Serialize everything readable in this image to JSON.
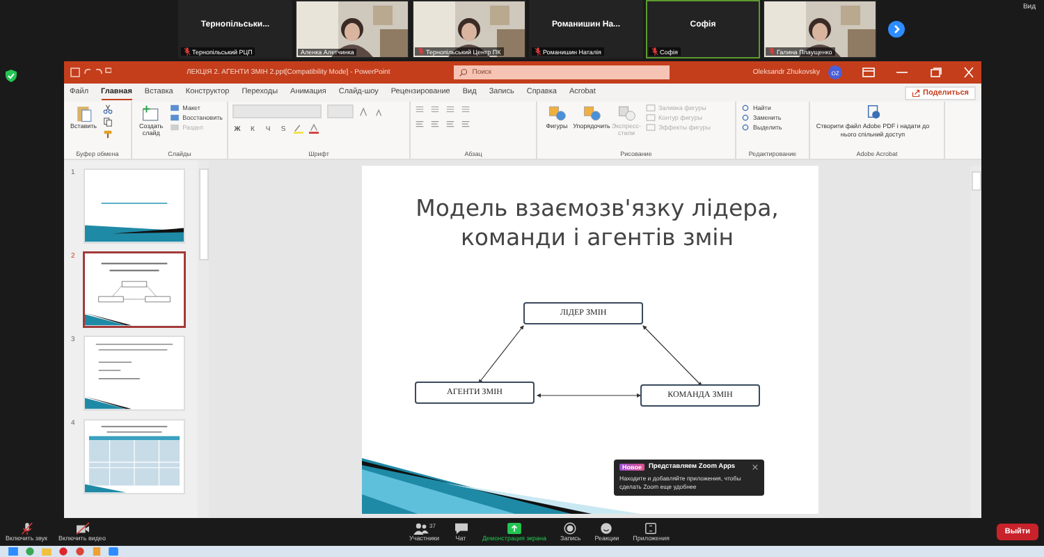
{
  "participants": [
    {
      "kind": "name",
      "name": "Тернопільськи...",
      "label": "Тернопільський РЦП",
      "muted": true,
      "speaking": false
    },
    {
      "kind": "video",
      "label": "Аленка Алетчинка",
      "muted": false,
      "speaking": false
    },
    {
      "kind": "video",
      "label": "Тернопільський Центр ПК",
      "muted": true,
      "speaking": false
    },
    {
      "kind": "name",
      "name": "Романишин  На...",
      "label": "Романишин Наталія",
      "muted": true,
      "speaking": false
    },
    {
      "kind": "name",
      "name": "Софія",
      "label": "Софія",
      "muted": true,
      "speaking": true
    },
    {
      "kind": "video",
      "label": "Галина Плаущенко",
      "muted": true,
      "speaking": false
    }
  ],
  "view_button": "Вид",
  "window": {
    "title": "ЛЕКЦІЯ 2. АГЕНТИ ЗМІН 2.ppt[Compatibility Mode]  -  PowerPoint",
    "search": {
      "placeholder": "Поиск"
    },
    "user": "Oleksandr Zhukovsky",
    "avatar": "OZ"
  },
  "tabs": [
    {
      "label": "Файл",
      "selected": false
    },
    {
      "label": "Главная",
      "selected": true
    },
    {
      "label": "Вставка",
      "selected": false
    },
    {
      "label": "Конструктор",
      "selected": false
    },
    {
      "label": "Переходы",
      "selected": false
    },
    {
      "label": "Анимация",
      "selected": false
    },
    {
      "label": "Слайд-шоу",
      "selected": false
    },
    {
      "label": "Рецензирование",
      "selected": false
    },
    {
      "label": "Вид",
      "selected": false
    },
    {
      "label": "Запись",
      "selected": false
    },
    {
      "label": "Справка",
      "selected": false
    },
    {
      "label": "Acrobat",
      "selected": false
    }
  ],
  "share_button": "Поделиться",
  "ribbon": [
    {
      "kind": "clipboard",
      "label": "Буфер обмена",
      "items": [
        {
          "label": "Вставить",
          "disabled": false
        }
      ]
    },
    {
      "kind": "slides",
      "label": "Слайды",
      "items": [
        {
          "label": "Создать слайд",
          "disabled": false
        },
        {
          "label": "Макет",
          "disabled": false
        },
        {
          "label": "Восстановить",
          "disabled": false
        },
        {
          "label": "Раздел",
          "disabled": true
        }
      ]
    },
    {
      "kind": "font",
      "label": "Шрифт",
      "items": [
        {
          "label": "Ж",
          "disabled": false
        },
        {
          "label": "К",
          "disabled": false
        },
        {
          "label": "Ч",
          "disabled": false
        },
        {
          "label": "S",
          "disabled": false
        }
      ]
    },
    {
      "kind": "paragraph",
      "label": "Абзац"
    },
    {
      "kind": "drawing",
      "label": "Рисование",
      "items": [
        {
          "label": "Фигуры",
          "disabled": false
        },
        {
          "label": "Упорядочить",
          "disabled": false
        },
        {
          "label": "Экспресс-стили",
          "disabled": true
        },
        {
          "label": "Заливка фигуры",
          "disabled": true
        },
        {
          "label": "Контур фигуры",
          "disabled": true
        },
        {
          "label": "Эффекты фигуры",
          "disabled": true
        }
      ]
    },
    {
      "kind": "editing",
      "label": "Редактирование",
      "items": [
        {
          "label": "Найти",
          "disabled": false
        },
        {
          "label": "Заменить",
          "disabled": false
        },
        {
          "label": "Выделить",
          "disabled": false
        }
      ]
    },
    {
      "kind": "acrobat",
      "label": "Adobe Acrobat",
      "items": [
        {
          "label": "Створити файл Adobe PDF і надати до нього спільний доступ",
          "disabled": false
        }
      ]
    }
  ],
  "slides": [
    {
      "number": "1",
      "kind": "title",
      "selected": false
    },
    {
      "number": "2",
      "kind": "diagram",
      "selected": true
    },
    {
      "number": "3",
      "kind": "bullets",
      "selected": false
    },
    {
      "number": "4",
      "kind": "table",
      "selected": false
    }
  ],
  "slide": {
    "title": "Модель взаємозв'язку лідера, команди і агентів змін",
    "boxes": [
      {
        "label": "ЛІДЕР ЗМІН"
      },
      {
        "label": "АГЕНТИ ЗМІН"
      },
      {
        "label": "КОМАНДА ЗМІН"
      }
    ]
  },
  "popup": {
    "badge": "Новое",
    "title": "Представляем Zoom Apps",
    "text": "Находите и добавляйте приложения, чтобы сделать Zoom еще удобнее"
  },
  "controls": [
    {
      "kind": "mic",
      "label": "Включить звук"
    },
    {
      "kind": "video",
      "label": "Включить видео"
    },
    {
      "kind": "participants",
      "label": "Участники",
      "count": "37"
    },
    {
      "kind": "chat",
      "label": "Чат"
    },
    {
      "kind": "share",
      "label": "Демонстрация экрана"
    },
    {
      "kind": "record",
      "label": "Запись"
    },
    {
      "kind": "reactions",
      "label": "Реакции"
    },
    {
      "kind": "apps",
      "label": "Приложения"
    }
  ],
  "leave_button": "Выйти"
}
